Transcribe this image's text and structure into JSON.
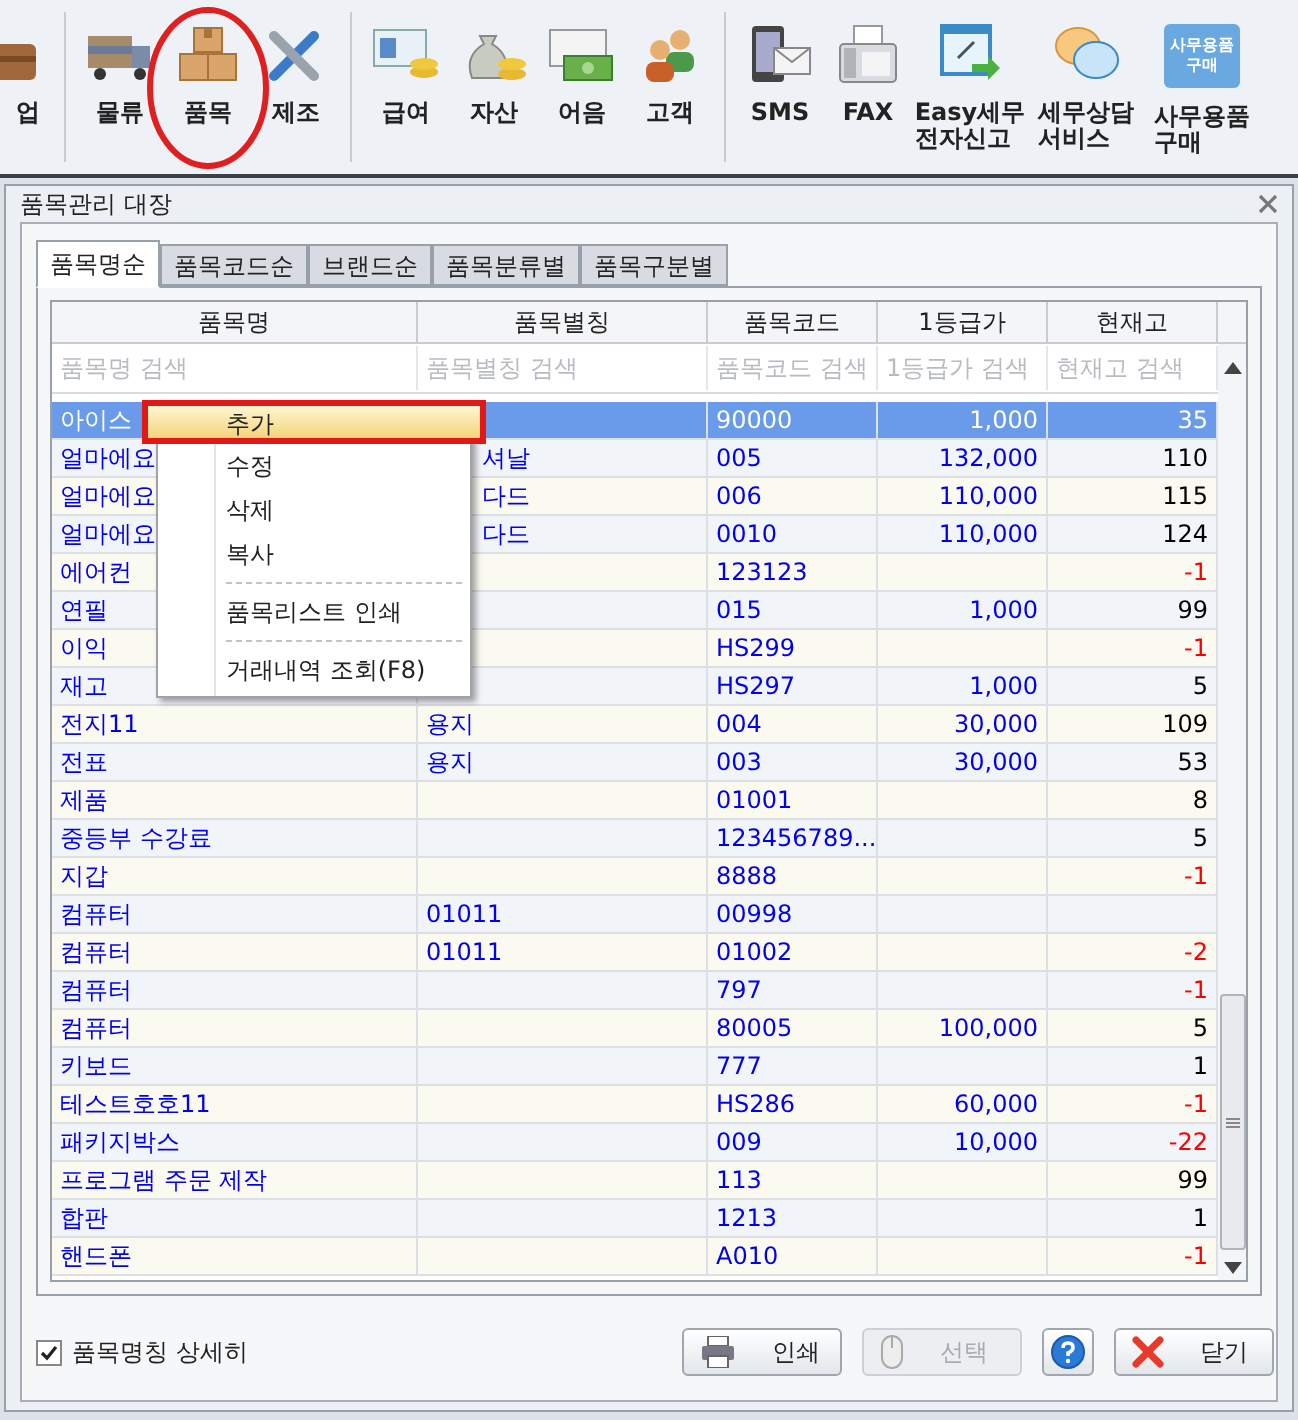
{
  "toolbar": [
    {
      "label": [
        "업"
      ],
      "kind": "briefcase",
      "selected": false
    },
    {
      "label": [
        "물류"
      ],
      "kind": "truck",
      "selected": false
    },
    {
      "label": [
        "품목"
      ],
      "kind": "boxes",
      "selected": true
    },
    {
      "label": [
        "제조"
      ],
      "kind": "tools",
      "selected": false
    },
    {
      "label": [
        "급여"
      ],
      "kind": "card",
      "selected": false
    },
    {
      "label": [
        "자산"
      ],
      "kind": "moneybag",
      "selected": false
    },
    {
      "label": [
        "어음"
      ],
      "kind": "bill",
      "selected": false
    },
    {
      "label": [
        "고객"
      ],
      "kind": "people",
      "selected": false
    },
    {
      "label": [
        "SMS"
      ],
      "kind": "phone",
      "selected": false
    },
    {
      "label": [
        "FAX"
      ],
      "kind": "fax",
      "selected": false
    },
    {
      "label": [
        "Easy세무",
        "전자신고"
      ],
      "kind": "percent",
      "selected": false
    },
    {
      "label": [
        "세무상담",
        "서비스"
      ],
      "kind": "chat",
      "selected": false
    },
    {
      "label": [
        "사무용품",
        "구매"
      ],
      "kind": "shop",
      "icon_text": [
        "사무용품",
        "구매"
      ],
      "selected": false
    }
  ],
  "window": {
    "title": "품목관리 대장"
  },
  "tabs": [
    {
      "label": "품목명순",
      "selected": true
    },
    {
      "label": "품목코드순",
      "selected": false
    },
    {
      "label": "브랜드순",
      "selected": false
    },
    {
      "label": "품목분류별",
      "selected": false
    },
    {
      "label": "품목구분별",
      "selected": false
    }
  ],
  "table": {
    "columns": [
      "품목명",
      "품목별칭",
      "품목코드",
      "1등급가",
      "현재고"
    ],
    "search_placeholders": [
      "품목명 검색",
      "품목별칭 검색",
      "품목코드 검색",
      "1등급가 검색",
      "현재고 검색"
    ],
    "rows": [
      {
        "cells": [
          "아이스",
          "",
          "90000",
          "1,000",
          "35"
        ],
        "selected": true
      },
      {
        "cells": [
          "얼마에요",
          "셔날",
          "005",
          "132,000",
          "110"
        ],
        "selected": false,
        "negative": false,
        "alias_under_menu": true
      },
      {
        "cells": [
          "얼마에요",
          "다드",
          "006",
          "110,000",
          "115"
        ],
        "selected": false,
        "negative": false,
        "alias_under_menu": true
      },
      {
        "cells": [
          "얼마에요",
          "다드",
          "0010",
          "110,000",
          "124"
        ],
        "selected": false,
        "negative": false,
        "alias_under_menu": true
      },
      {
        "cells": [
          "에어컨",
          "",
          "123123",
          "",
          "-1"
        ],
        "selected": false,
        "negative": true
      },
      {
        "cells": [
          "연필",
          "",
          "015",
          "1,000",
          "99"
        ],
        "selected": false,
        "negative": false
      },
      {
        "cells": [
          "이익",
          "",
          "HS299",
          "",
          "-1"
        ],
        "selected": false,
        "negative": true
      },
      {
        "cells": [
          "재고",
          "",
          "HS297",
          "1,000",
          "5"
        ],
        "selected": false,
        "negative": false
      },
      {
        "cells": [
          "전지11",
          "용지",
          "004",
          "30,000",
          "109"
        ],
        "selected": false,
        "negative": false
      },
      {
        "cells": [
          "전표",
          "용지",
          "003",
          "30,000",
          "53"
        ],
        "selected": false,
        "negative": false
      },
      {
        "cells": [
          "제품",
          "",
          "01001",
          "",
          "8"
        ],
        "selected": false,
        "negative": false
      },
      {
        "cells": [
          "중등부 수강료",
          "",
          "123456789...",
          "",
          "5"
        ],
        "selected": false,
        "negative": false
      },
      {
        "cells": [
          "지갑",
          "",
          "8888",
          "",
          "-1"
        ],
        "selected": false,
        "negative": true
      },
      {
        "cells": [
          "컴퓨터",
          "01011",
          "00998",
          "",
          ""
        ],
        "selected": false
      },
      {
        "cells": [
          "컴퓨터",
          "01011",
          "01002",
          "",
          "-2"
        ],
        "selected": false,
        "negative": true
      },
      {
        "cells": [
          "컴퓨터",
          "",
          "797",
          "",
          "-1"
        ],
        "selected": false,
        "negative": true
      },
      {
        "cells": [
          "컴퓨터",
          "",
          "80005",
          "100,000",
          "5"
        ],
        "selected": false,
        "negative": false
      },
      {
        "cells": [
          "키보드",
          "",
          "777",
          "",
          "1"
        ],
        "selected": false,
        "negative": false
      },
      {
        "cells": [
          "테스트호호11",
          "",
          "HS286",
          "60,000",
          "-1"
        ],
        "selected": false,
        "negative": true
      },
      {
        "cells": [
          "패키지박스",
          "",
          "009",
          "10,000",
          "-22"
        ],
        "selected": false,
        "negative": true
      },
      {
        "cells": [
          "프로그램 주문 제작",
          "",
          "113",
          "",
          "99"
        ],
        "selected": false,
        "negative": false
      },
      {
        "cells": [
          "합판",
          "",
          "1213",
          "",
          "1"
        ],
        "selected": false,
        "negative": false
      },
      {
        "cells": [
          "핸드폰",
          "",
          "A010",
          "",
          "-1"
        ],
        "selected": false,
        "negative": true
      }
    ]
  },
  "context_menu": [
    {
      "label": "추가",
      "selected": true,
      "separator_before": false
    },
    {
      "label": "수정",
      "selected": false,
      "separator_before": false
    },
    {
      "label": "삭제",
      "selected": false,
      "separator_before": false
    },
    {
      "label": "복사",
      "selected": false,
      "separator_before": false
    },
    {
      "label": "품목리스트 인쇄",
      "selected": false,
      "separator_before": true
    },
    {
      "label": "거래내역 조회(F8)",
      "selected": false,
      "separator_before": true
    }
  ],
  "detail_checkbox": {
    "label": "품목명칭 상세히",
    "checked": true
  },
  "buttons": [
    {
      "kind": "print",
      "label": "인쇄",
      "disabled": false
    },
    {
      "kind": "select",
      "label": "선택",
      "disabled": true
    },
    {
      "kind": "help",
      "disabled": false
    },
    {
      "kind": "close",
      "label": "닫기",
      "disabled": false
    }
  ]
}
